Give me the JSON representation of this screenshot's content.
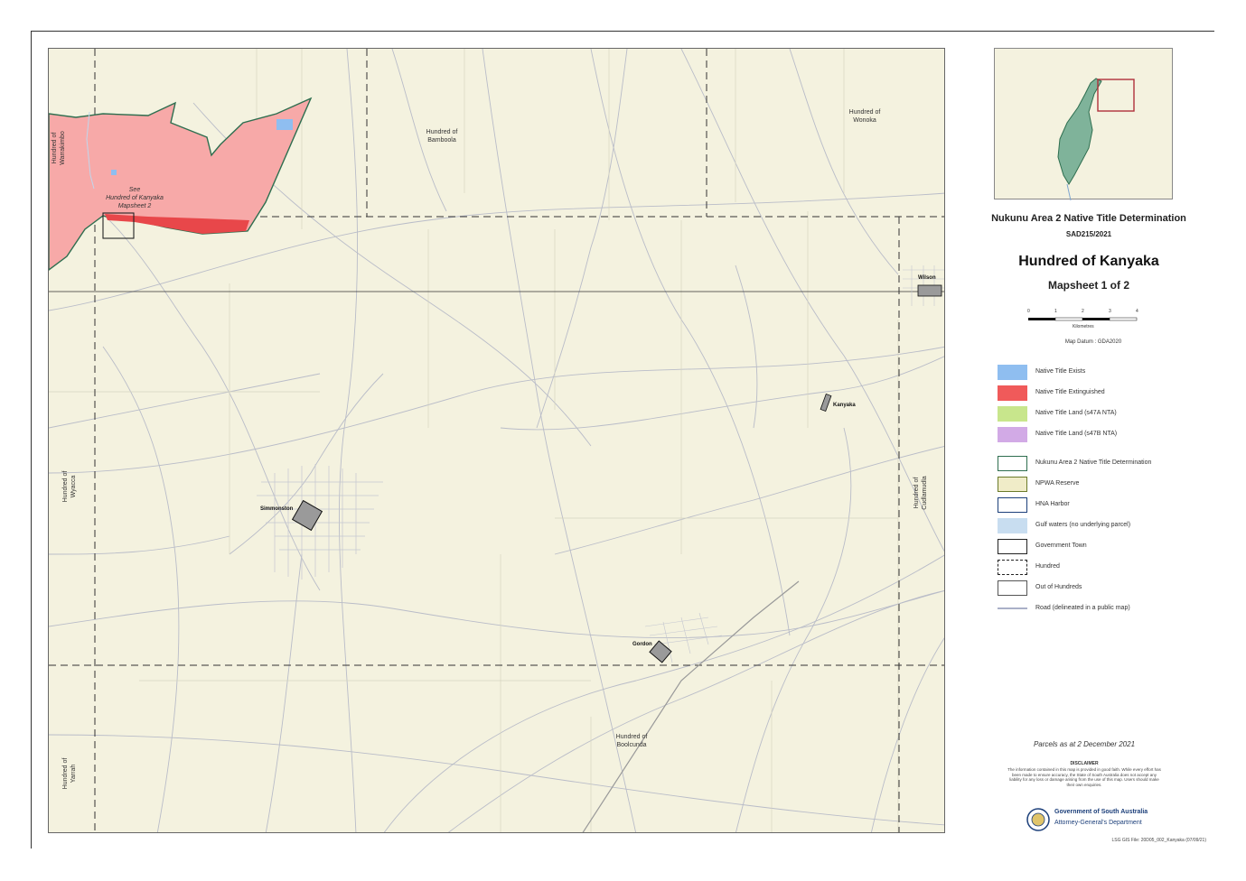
{
  "map": {
    "hundred_labels": {
      "bamboola": "Hundred of\nBamboola",
      "wonoka": "Hundred of\nWonoka",
      "boolcunda": "Hundred of\nBoolcunda",
      "warrakimbo": "Hundred of\nWarrakimbo",
      "wyacca": "Hundred of\nWyacca",
      "yarrah": "Hundred of\nYarrah",
      "cudlamudla": "Hundred of\nCudlamudla"
    },
    "towns": {
      "simmonston": "Simmonston",
      "gordon": "Gordon",
      "kanyaka": "Kanyaka",
      "wilson": "Wilson"
    },
    "see_note": "See\nHundred of Kanyaka\nMapsheet 2"
  },
  "header": {
    "determination": "Nukunu Area 2 Native Title Determination",
    "case_number": "SAD215/2021",
    "hundred": "Hundred of Kanyaka",
    "mapsheet": "Mapsheet 1 of 2"
  },
  "scale": {
    "ticks": [
      "0",
      "1",
      "2",
      "3",
      "4"
    ],
    "unit": "Kilometres"
  },
  "datum": "Map Datum : GDA2020",
  "legend": [
    {
      "label": "Native Title Exists",
      "color": "#8fbef0",
      "border": "#8fbef0"
    },
    {
      "label": "Native Title Extinguished",
      "color": "#f05a5a",
      "border": "#f05a5a"
    },
    {
      "label": "Native Title Land (s47A NTA)",
      "color": "#c8e68c",
      "border": "#c8e68c"
    },
    {
      "label": "Native Title Land (s47B NTA)",
      "color": "#d2aae6",
      "border": "#d2aae6"
    },
    {
      "label": "Nukunu Area 2 Native Title Determination",
      "color": "#ffffff",
      "border": "#2e6e4f"
    },
    {
      "label": "NPWA Reserve",
      "color": "#f0ecc8",
      "border": "#6b7b2a"
    },
    {
      "label": "HNA Harbor",
      "color": "#ffffff",
      "border": "#1c3f7a"
    },
    {
      "label": "Gulf waters (no underlying parcel)",
      "color": "#c8ddf0",
      "border": "#c8ddf0"
    },
    {
      "label": "Government Town",
      "color": "#ffffff",
      "border": "#222222"
    },
    {
      "label": "Hundred",
      "color": "#ffffff",
      "border": "#222222"
    },
    {
      "label": "Out of Hundreds",
      "color": "#ffffff",
      "border": "#555555"
    },
    {
      "label": "Road (delineated in a public map)",
      "color": "#ffffff",
      "border": "#aab0c8"
    }
  ],
  "parcels_note": "Parcels as at 2 December 2021",
  "disclaimer": {
    "title": "DISCLAIMER",
    "body": "The information contained in this map is provided in good faith. While every effort has been made to ensure accuracy, the State of South Australia does not accept any liability for any loss or damage arising from the use of this map. Users should make their own enquiries."
  },
  "government": {
    "line1": "Government of South Australia",
    "line2": "Attorney-General's Department"
  },
  "footer": "LSG GIS File: 20D05_002_Kanyaka (07/09/21)",
  "colors": {
    "determination_fill": "#f7a9a8",
    "extinguished": "#e8474a",
    "boundary": "#2e6e4f"
  }
}
